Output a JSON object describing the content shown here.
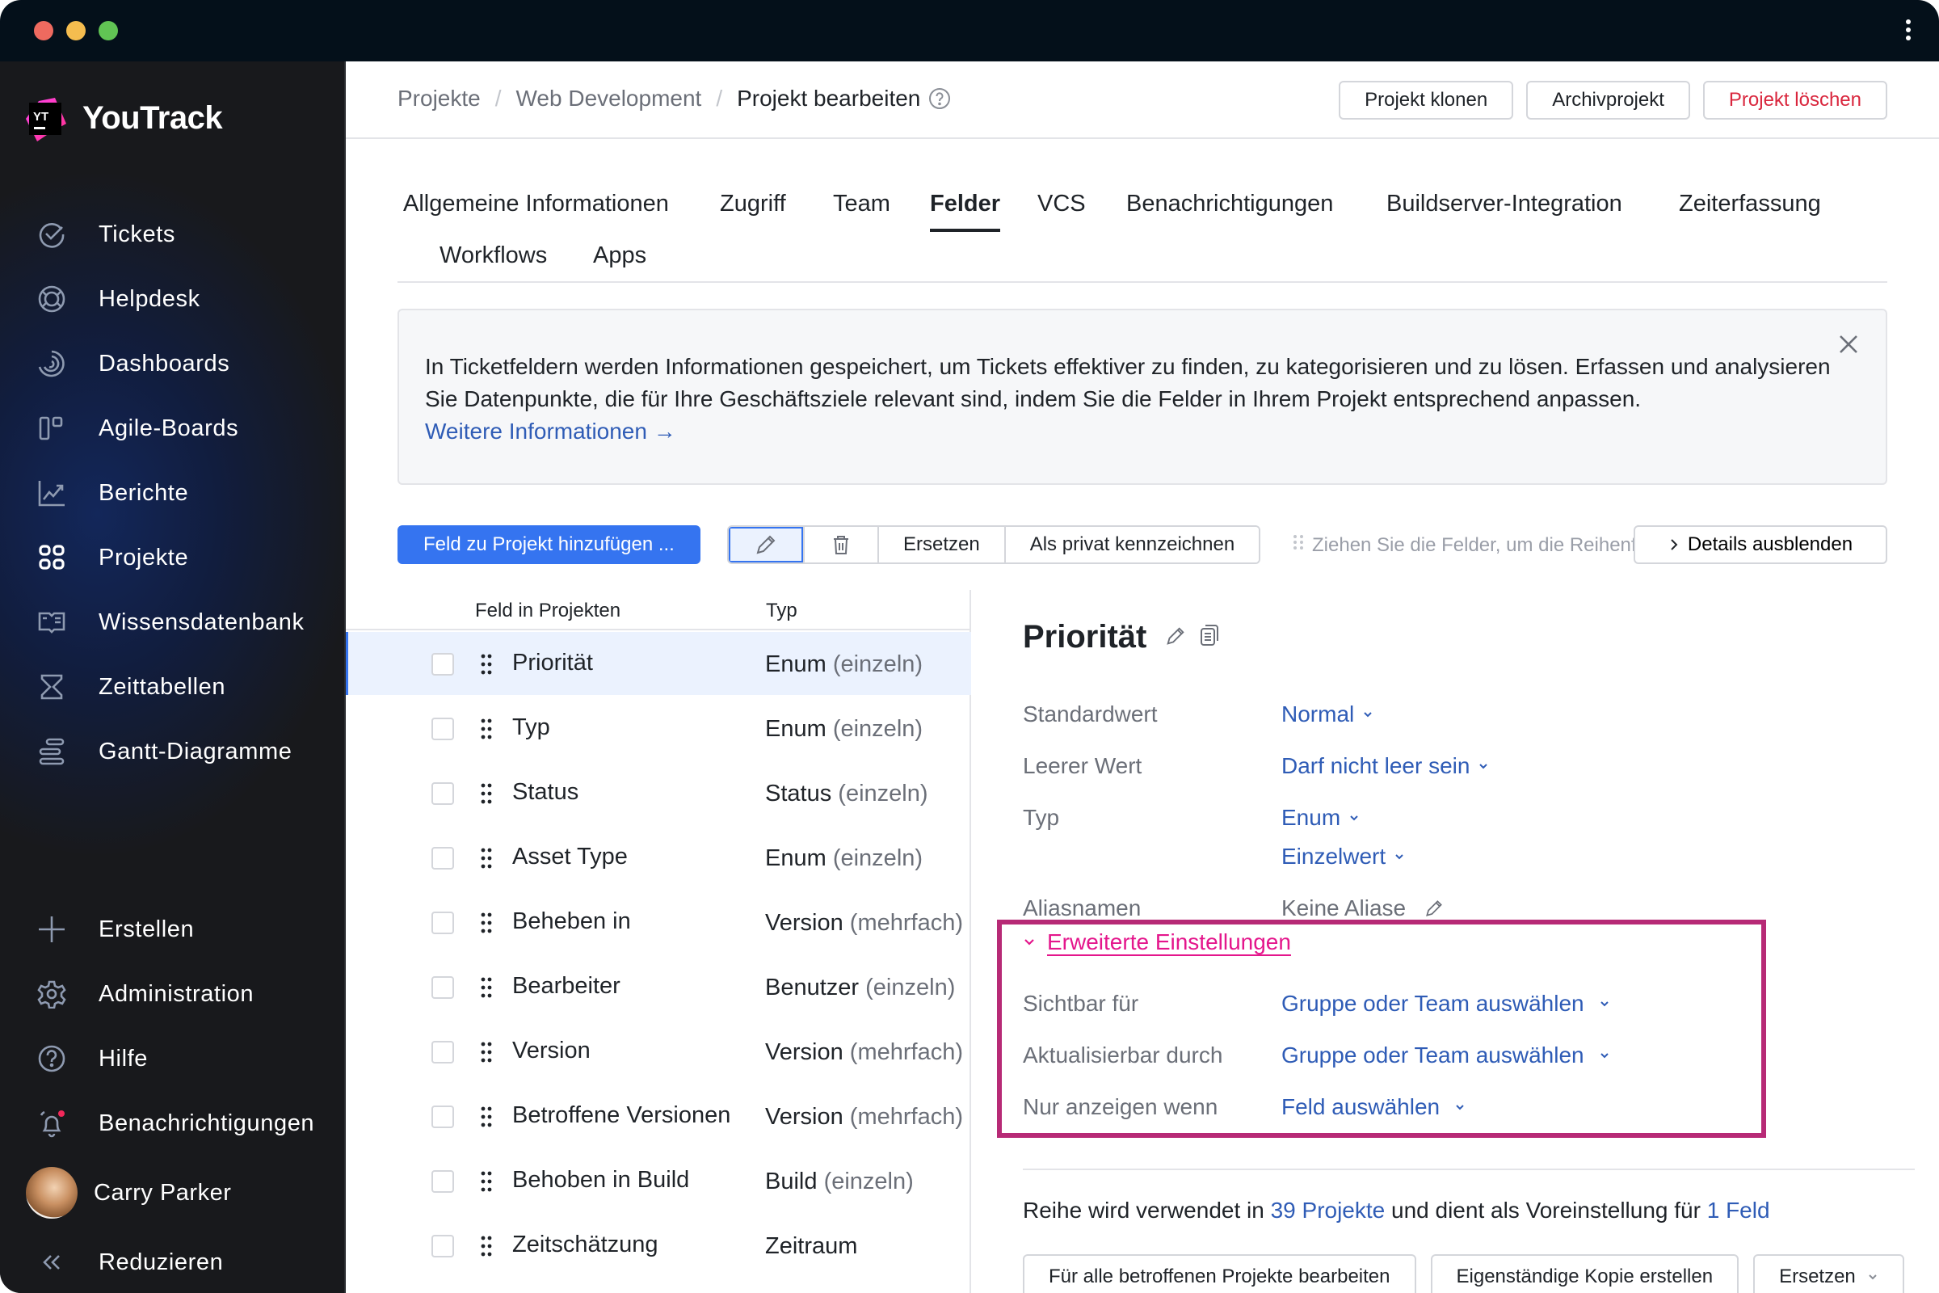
{
  "window": {
    "controls": [
      "close",
      "minimize",
      "maximize"
    ],
    "menu_icon": "more-vertical-icon"
  },
  "app": {
    "name": "YouTrack",
    "logo_text": "YT"
  },
  "sidebar": {
    "items": [
      {
        "label": "Tickets",
        "icon": "check-circle-icon"
      },
      {
        "label": "Helpdesk",
        "icon": "lifebuoy-icon"
      },
      {
        "label": "Dashboards",
        "icon": "dashboard-icon"
      },
      {
        "label": "Agile-Boards",
        "icon": "board-icon"
      },
      {
        "label": "Berichte",
        "icon": "chart-icon"
      },
      {
        "label": "Projekte",
        "icon": "grid-icon"
      },
      {
        "label": "Wissensdatenbank",
        "icon": "book-icon"
      },
      {
        "label": "Zeittabellen",
        "icon": "hourglass-icon"
      },
      {
        "label": "Gantt-Diagramme",
        "icon": "gantt-icon"
      }
    ],
    "bottom": [
      {
        "label": "Erstellen",
        "icon": "plus-icon"
      },
      {
        "label": "Administration",
        "icon": "gear-icon"
      },
      {
        "label": "Hilfe",
        "icon": "help-icon"
      },
      {
        "label": "Benachrichtigungen",
        "icon": "bell-icon"
      }
    ],
    "user": {
      "name": "Carry Parker"
    },
    "collapse_label": "Reduzieren"
  },
  "header": {
    "breadcrumb": [
      "Projekte",
      "Web Development",
      "Projekt bearbeiten"
    ],
    "buttons": {
      "clone": "Projekt klonen",
      "archive": "Archivprojekt",
      "delete": "Projekt löschen"
    }
  },
  "tabs": [
    {
      "label": "Allgemeine Informationen",
      "active": false
    },
    {
      "label": "Zugriff",
      "active": false
    },
    {
      "label": "Team",
      "active": false
    },
    {
      "label": "Felder",
      "active": true
    },
    {
      "label": "VCS",
      "active": false
    },
    {
      "label": "Benachrichtigungen",
      "active": false
    },
    {
      "label": "Buildserver-Integration",
      "active": false
    },
    {
      "label": "Zeiterfassung",
      "active": false
    },
    {
      "label": "Workflows",
      "active": false
    },
    {
      "label": "Apps",
      "active": false
    }
  ],
  "banner": {
    "text": "In Ticketfeldern werden Informationen gespeichert, um Tickets effektiver zu finden, zu kategorisieren und zu lösen. Erfassen und analysieren Sie Datenpunkte, die für Ihre Geschäftsziele relevant sind, indem Sie die Felder in Ihrem Projekt entsprechend anpassen.",
    "link": "Weitere Informationen →"
  },
  "toolbar": {
    "add_field": "Feld zu Projekt hinzufügen ...",
    "replace": "Ersetzen",
    "mark_private": "Als privat kennzeichnen",
    "hint": "Ziehen Sie die Felder, um die Reihenfolge zu konfigurieren",
    "hide_details": "Details ausblenden"
  },
  "table": {
    "columns": [
      "Feld in Projekten",
      "Typ"
    ],
    "rows": [
      {
        "name": "Priorität",
        "type": "Enum",
        "qualifier": "(einzeln)",
        "selected": true
      },
      {
        "name": "Typ",
        "type": "Enum",
        "qualifier": "(einzeln)",
        "selected": false
      },
      {
        "name": "Status",
        "type": "Status",
        "qualifier": "(einzeln)",
        "selected": false
      },
      {
        "name": "Asset Type",
        "type": "Enum",
        "qualifier": "(einzeln)",
        "selected": false
      },
      {
        "name": "Beheben in",
        "type": "Version",
        "qualifier": "(mehrfach)",
        "selected": false
      },
      {
        "name": "Bearbeiter",
        "type": "Benutzer",
        "qualifier": "(einzeln)",
        "selected": false
      },
      {
        "name": "Version",
        "type": "Version",
        "qualifier": "(mehrfach)",
        "selected": false
      },
      {
        "name": "Betroffene Versionen",
        "type": "Version",
        "qualifier": "(mehrfach)",
        "selected": false
      },
      {
        "name": "Behoben in Build",
        "type": "Build",
        "qualifier": "(einzeln)",
        "selected": false
      },
      {
        "name": "Zeitschätzung",
        "type": "Zeitraum",
        "qualifier": "",
        "selected": false
      }
    ]
  },
  "details": {
    "title": "Priorität",
    "props": {
      "default_label": "Standardwert",
      "default_value": "Normal",
      "empty_label": "Leerer Wert",
      "empty_value": "Darf nicht leer sein",
      "type_label": "Typ",
      "type_value": "Enum",
      "type_mult": "Einzelwert",
      "alias_label": "Aliasnamen",
      "alias_value": "Keine Aliase"
    },
    "advanced": {
      "toggle": "Erweiterte Einstellungen",
      "visible_label": "Sichtbar für",
      "visible_value": "Gruppe oder Team auswählen",
      "update_label": "Aktualisierbar durch",
      "update_value": "Gruppe oder Team auswählen",
      "show_if_label": "Nur anzeigen wenn",
      "show_if_value": "Feld auswählen"
    },
    "usage": {
      "prefix": "Reihe wird verwendet in ",
      "projects_link": "39 Projekte",
      "middle": " und dient als Voreinstellung für ",
      "fields_link": "1 Feld"
    },
    "buttons": {
      "edit_all": "Für alle betroffenen Projekte bearbeiten",
      "copy": "Eigenständige Kopie erstellen",
      "replace": "Ersetzen"
    }
  },
  "colors": {
    "accent": "#3574f0",
    "link": "#2f5cb6",
    "danger": "#d9263d",
    "highlight": "#b72a76",
    "advanced_link": "#e4168c"
  }
}
